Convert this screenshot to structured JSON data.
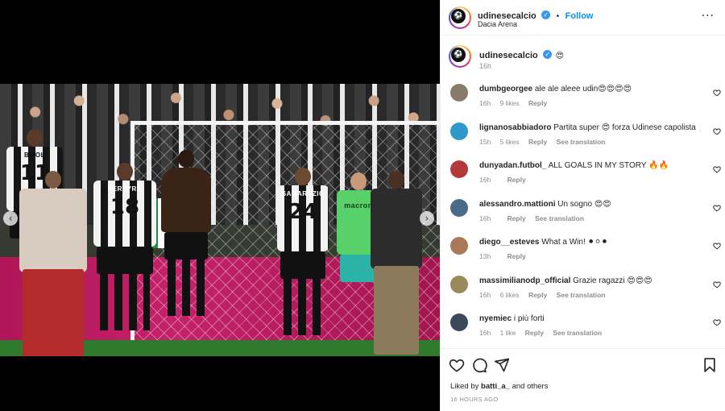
{
  "post": {
    "username": "udinesecalcio",
    "follow_label": "Follow",
    "location": "Dacia Arena",
    "caption_emoji": "😍",
    "caption_time": "16h"
  },
  "media": {
    "jersey_numbers": [
      "11",
      "18",
      "24"
    ],
    "jersey_names": [
      "BIJOL",
      "PEREYRA",
      "SAMARDZIC"
    ],
    "sponsor_text": "macron",
    "carousel_dots": 6,
    "active_dot": 4
  },
  "comments": [
    {
      "user": "dumbgeorgee",
      "text": "ale ale aleee udin😍😍😍😍",
      "time": "16h",
      "likes": "9 likes",
      "reply": "Reply",
      "translate": "",
      "avatar_color": "#8a7a6a"
    },
    {
      "user": "lignanosabbiadoro",
      "text": "Partita super 😍 forza Udinese capolista 🦵🏻👟👟",
      "time": "15h",
      "likes": "5 likes",
      "reply": "Reply",
      "translate": "See translation",
      "avatar_color": "#2f9ac9"
    },
    {
      "user": "dunyadan.futbol_",
      "text": "ALL GOALS IN MY STORY 🔥🔥",
      "time": "16h",
      "likes": "",
      "reply": "Reply",
      "translate": "",
      "avatar_color": "#b33a3a"
    },
    {
      "user": "alessandro.mattioni",
      "text": "Un sogno 😍😍",
      "time": "16h",
      "likes": "",
      "reply": "Reply",
      "translate": "See translation",
      "avatar_color": "#4a6a8a"
    },
    {
      "user": "diego__esteves",
      "text": "What a Win! ⚫⚪⚫",
      "time": "13h",
      "likes": "",
      "reply": "Reply",
      "translate": "",
      "avatar_color": "#a87a5a"
    },
    {
      "user": "massimilianodp_official",
      "text": "Grazie ragazzi 😍😍😍",
      "time": "16h",
      "likes": "6 likes",
      "reply": "Reply",
      "translate": "See translation",
      "avatar_color": "#9a8a5a"
    },
    {
      "user": "nyemiec",
      "text": "i più forti",
      "time": "16h",
      "likes": "1 like",
      "reply": "Reply",
      "translate": "See translation",
      "avatar_color": "#3a4a5a"
    }
  ],
  "footer": {
    "liked_prefix": "Liked by",
    "liked_user": "batti_a_",
    "liked_suffix": "and others",
    "time_ago": "16 HOURS AGO"
  },
  "icons": {
    "like": "heart-icon",
    "comment": "comment-icon",
    "share": "share-icon",
    "save": "bookmark-icon",
    "more": "more-icon"
  }
}
